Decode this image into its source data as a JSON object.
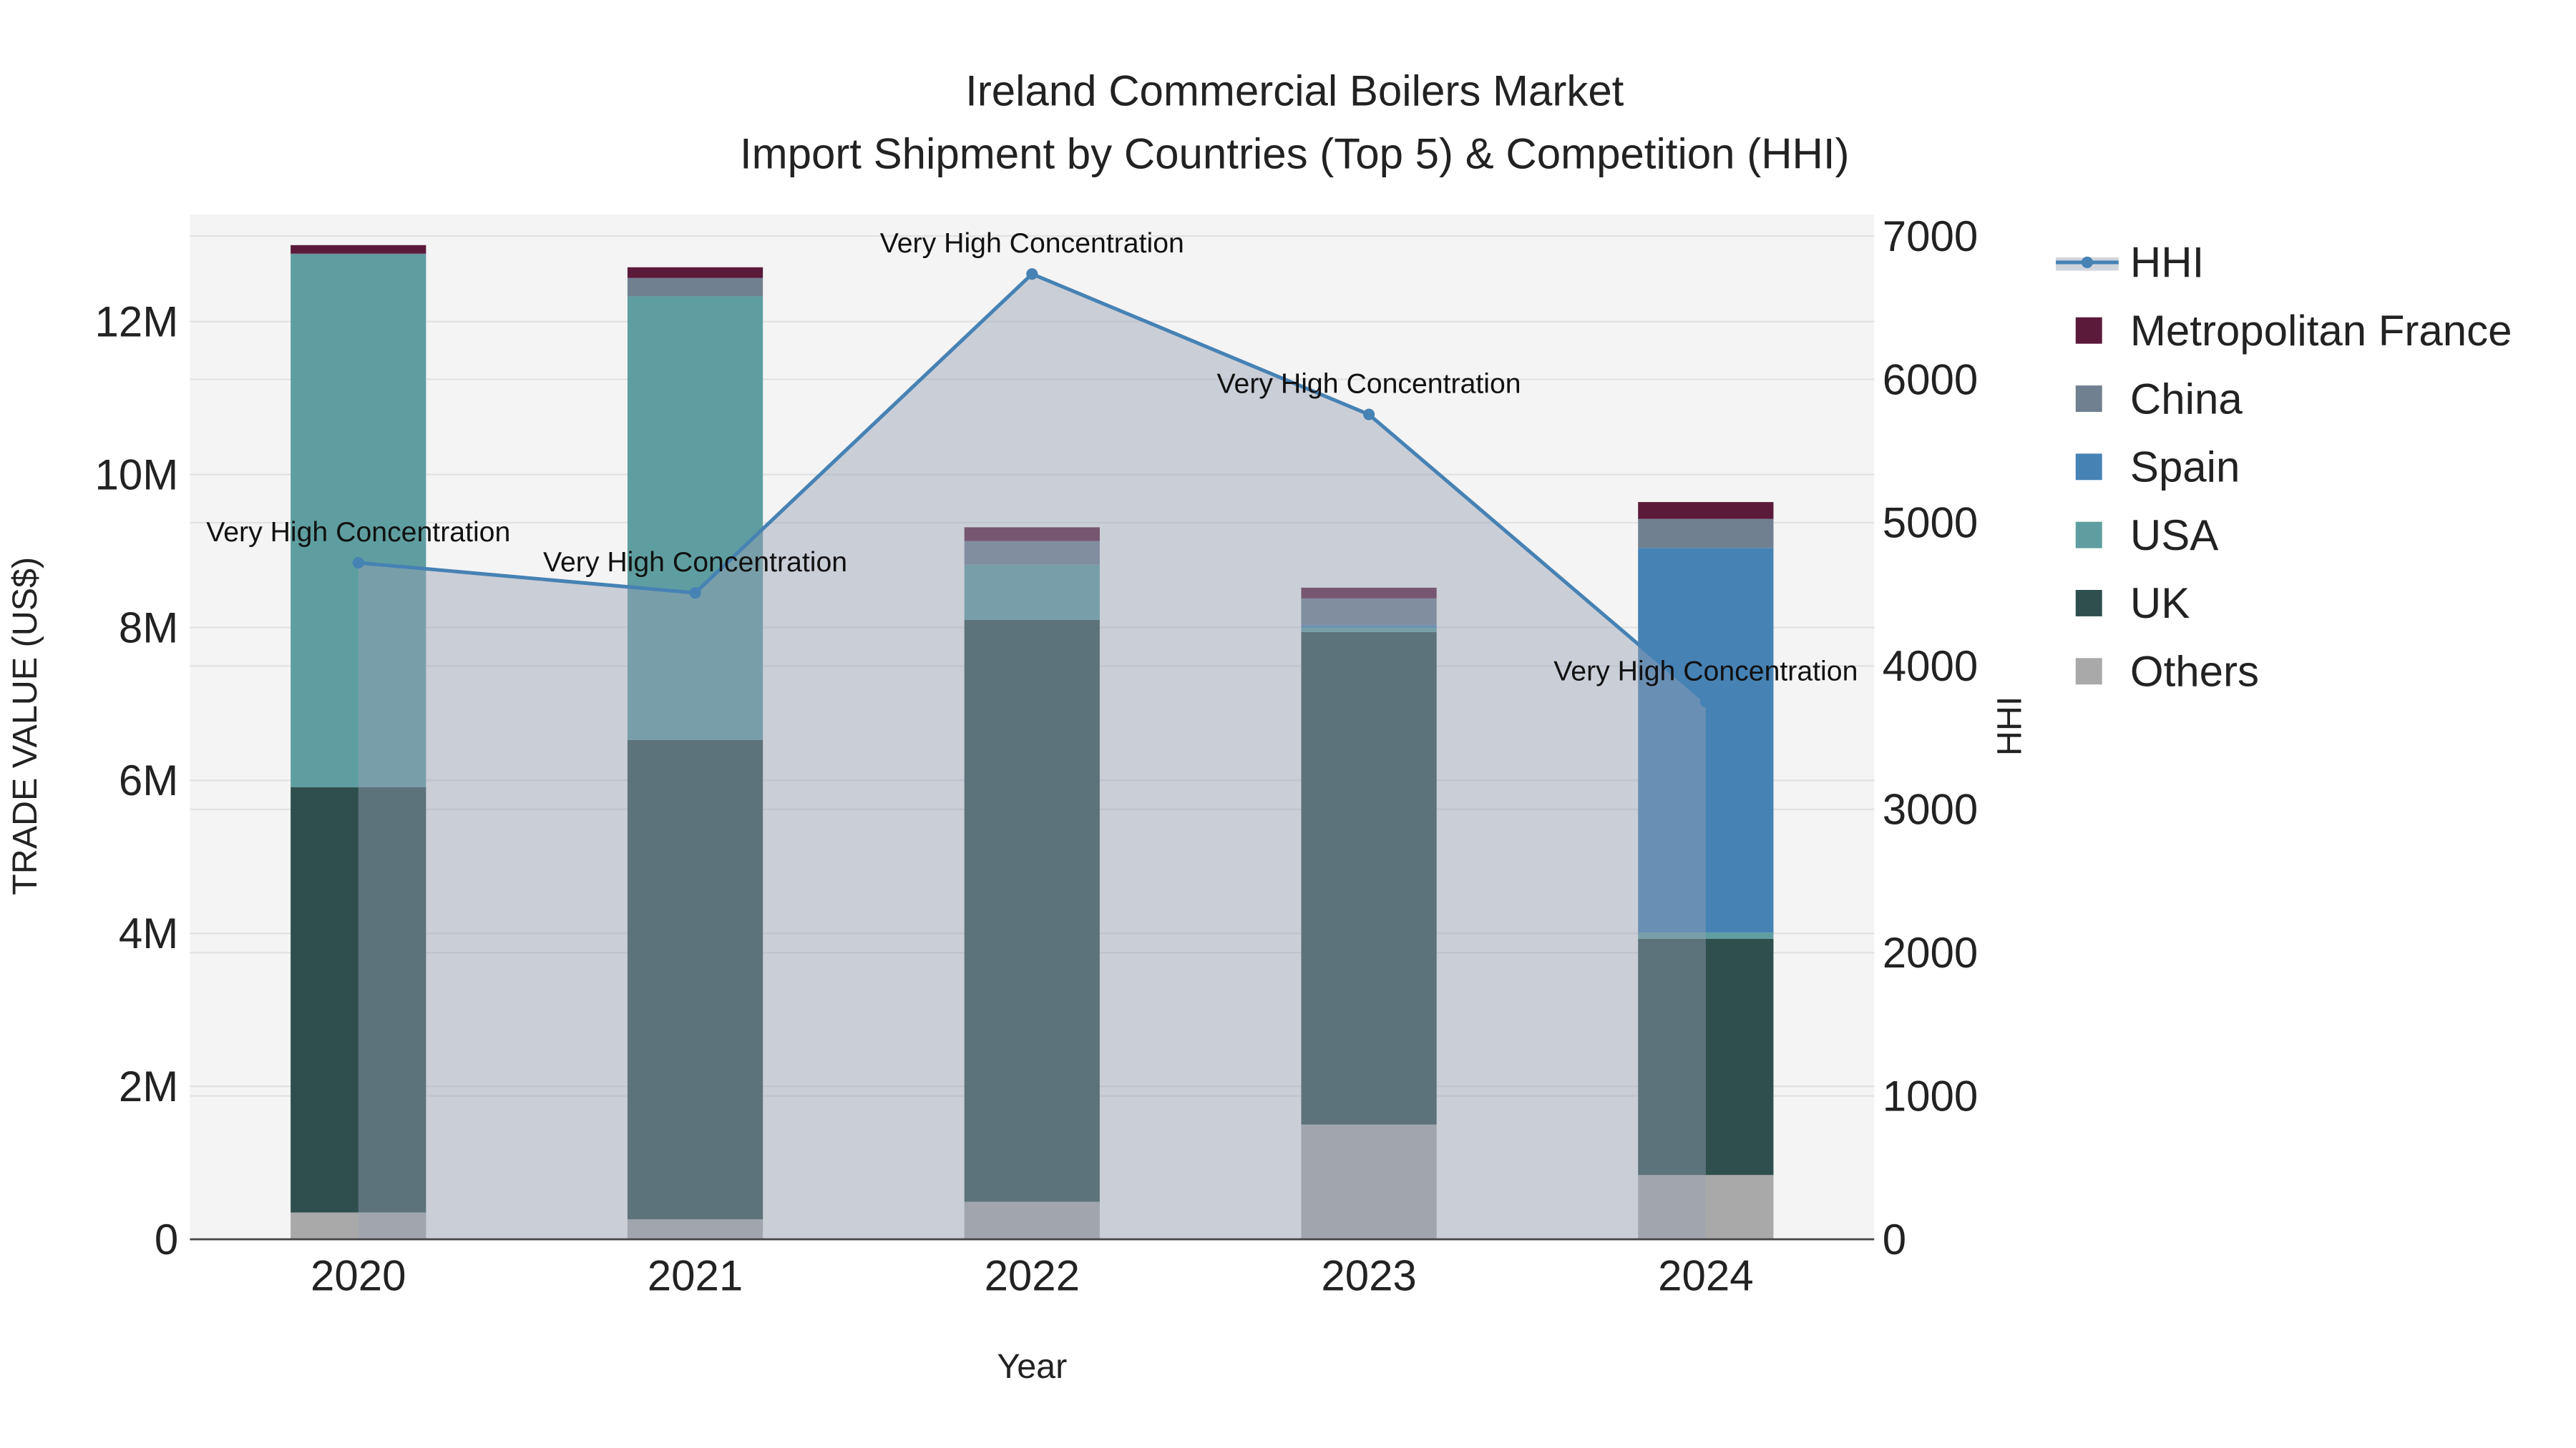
{
  "chart_data": {
    "type": "bar",
    "stacked": true,
    "title": "Ireland Commercial Boilers Market",
    "subtitle": "Import Shipment by Countries (Top 5) & Competition (HHI)",
    "xlabel": "Year",
    "ylabel": "TRADE VALUE (US$)",
    "y2label": "HHI",
    "categories": [
      "2020",
      "2021",
      "2022",
      "2023",
      "2024"
    ],
    "ylim": [
      0,
      13400000
    ],
    "y2lim": [
      0,
      7150
    ],
    "yticks": [
      {
        "value": 0,
        "label": "0"
      },
      {
        "value": 2000000,
        "label": "2M"
      },
      {
        "value": 4000000,
        "label": "4M"
      },
      {
        "value": 6000000,
        "label": "6M"
      },
      {
        "value": 8000000,
        "label": "8M"
      },
      {
        "value": 10000000,
        "label": "10M"
      },
      {
        "value": 12000000,
        "label": "12M"
      }
    ],
    "y2ticks": [
      {
        "value": 0,
        "label": "0"
      },
      {
        "value": 1000,
        "label": "1000"
      },
      {
        "value": 2000,
        "label": "2000"
      },
      {
        "value": 3000,
        "label": "3000"
      },
      {
        "value": 4000,
        "label": "4000"
      },
      {
        "value": 5000,
        "label": "5000"
      },
      {
        "value": 6000,
        "label": "6000"
      },
      {
        "value": 7000,
        "label": "7000"
      }
    ],
    "series": [
      {
        "name": "Others",
        "color": "#A9A9A9",
        "values": [
          350000,
          260000,
          490000,
          1500000,
          840000
        ]
      },
      {
        "name": "UK",
        "color": "#2F4F4F",
        "values": [
          5560000,
          6270000,
          7610000,
          6440000,
          3090000
        ]
      },
      {
        "name": "USA",
        "color": "#5F9EA0",
        "values": [
          6970000,
          5800000,
          720000,
          60000,
          80000
        ]
      },
      {
        "name": "Spain",
        "color": "#4682B4",
        "values": [
          0,
          0,
          0,
          30000,
          5030000
        ]
      },
      {
        "name": "China",
        "color": "#708090",
        "values": [
          10000,
          240000,
          310000,
          350000,
          380000
        ]
      },
      {
        "name": "Metropolitan France",
        "color": "#5C1A3A",
        "values": [
          110000,
          140000,
          180000,
          140000,
          220000
        ]
      }
    ],
    "hhi": {
      "name": "HHI",
      "color": "#4682B4",
      "values": [
        4720,
        4510,
        6735,
        5755,
        3750
      ],
      "annotations": [
        "Very High Concentration",
        "Very High Concentration",
        "Very High Concentration",
        "Very High Concentration",
        "Very High Concentration"
      ]
    },
    "legend_position": "right",
    "grid": true
  }
}
